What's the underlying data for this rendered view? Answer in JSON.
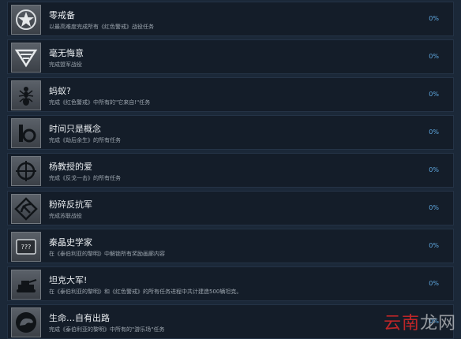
{
  "achievements": [
    {
      "title": "零戒备",
      "desc": "以最高难度完成所有《红色警戒》战役任务",
      "pct": "0%",
      "icon": "soviet-star-badge-icon"
    },
    {
      "title": "毫无悔意",
      "desc": "完成盟军战役",
      "pct": "0%",
      "icon": "allied-eagle-icon"
    },
    {
      "title": "蚂蚁?",
      "desc": "完成《红色警戒》中所有的\"它来自!\"任务",
      "pct": "0%",
      "icon": "ant-icon"
    },
    {
      "title": "时间只是概念",
      "desc": "完成《劫后余生》的所有任务",
      "pct": "0%",
      "icon": "time-gear-icon"
    },
    {
      "title": "杨教授的爱",
      "desc": "完成《反戈一击》的所有任务",
      "pct": "0%",
      "icon": "crosshair-icon"
    },
    {
      "title": "粉碎反抗军",
      "desc": "完成苏联战役",
      "pct": "0%",
      "icon": "hammer-sickle-icon"
    },
    {
      "title": "秦晶史学家",
      "desc": "在《泰伯利亚的黎明》中解锁所有奖励画廊内容",
      "pct": "0%",
      "icon": "question-box-icon"
    },
    {
      "title": "坦克大军!",
      "desc": "在《泰伯利亚的黎明》和《红色警戒》的所有任务进程中共计建造500辆坦克。",
      "pct": "0%",
      "icon": "tank-icon"
    },
    {
      "title": "生命…自有出路",
      "desc": "完成《泰伯利亚的黎明》中所有的\"游乐场\"任务",
      "pct": "0%",
      "icon": "dinosaur-icon"
    }
  ],
  "watermark": {
    "part1": "云南",
    "part2": "龙网"
  }
}
